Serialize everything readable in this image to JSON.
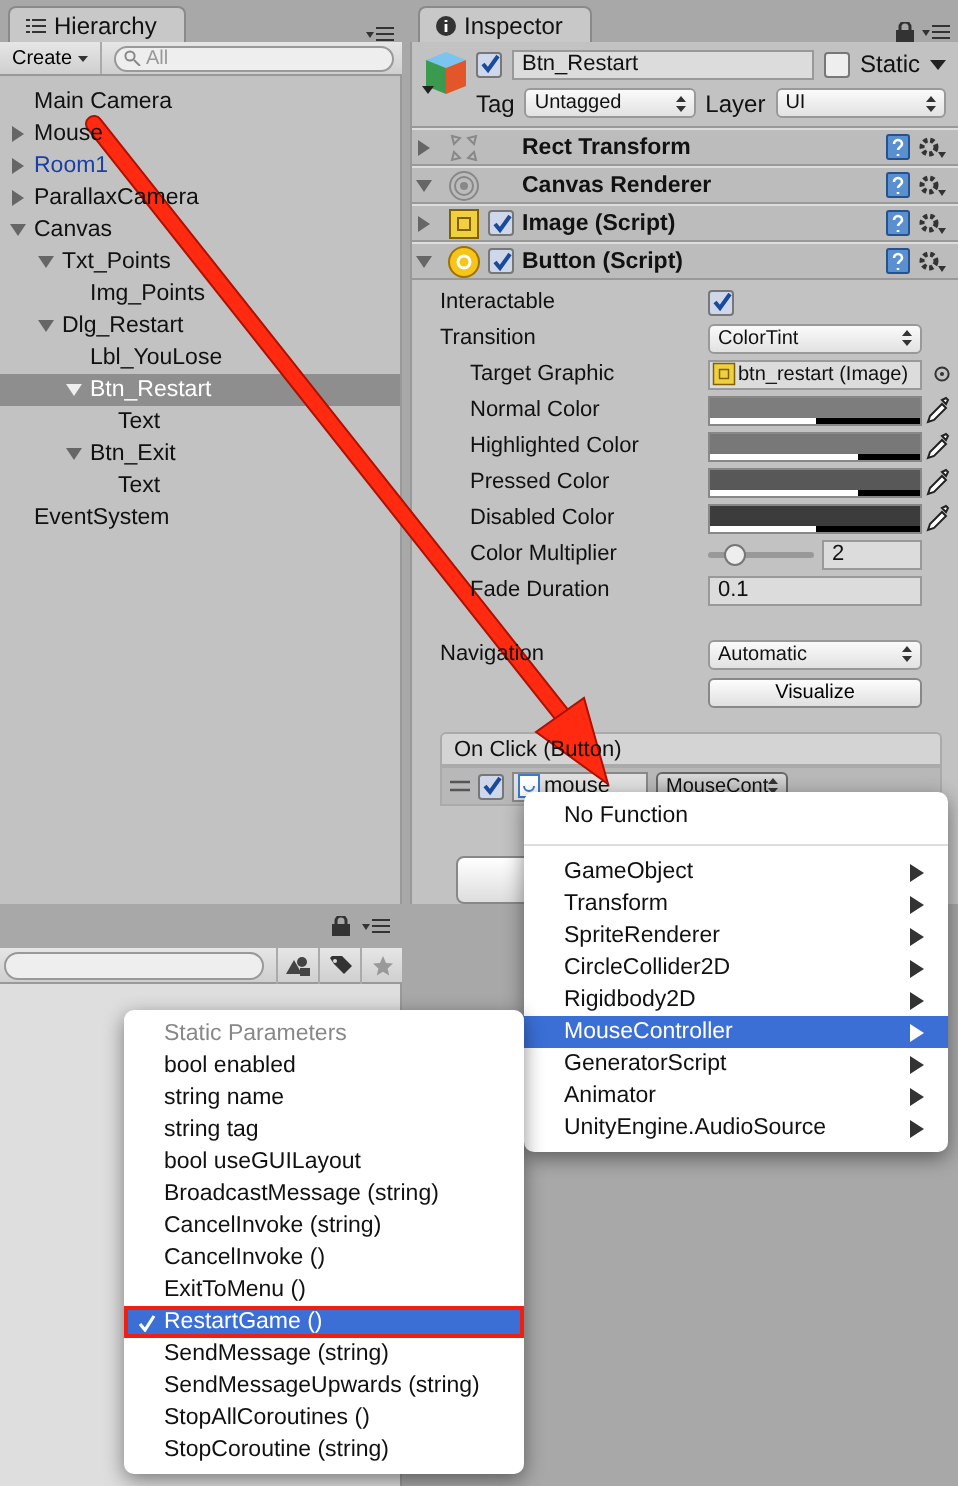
{
  "hierarchy": {
    "tab": "Hierarchy",
    "create_button": "Create",
    "search_placeholder": "All",
    "items": [
      {
        "label": "Main Camera",
        "kind": "object",
        "selected": false
      },
      {
        "label": "Mouse",
        "kind": "object",
        "expanded": false,
        "selected": false
      },
      {
        "label": "Room1",
        "kind": "prefab",
        "expanded": false,
        "selected": false
      },
      {
        "label": "ParallaxCamera",
        "kind": "object",
        "expanded": false,
        "selected": false
      },
      {
        "label": "Canvas",
        "kind": "object",
        "expanded": true,
        "selected": false,
        "children": [
          {
            "label": "Txt_Points",
            "kind": "object",
            "expanded": true,
            "selected": false,
            "children": [
              {
                "label": "Img_Points",
                "kind": "object",
                "selected": false
              }
            ]
          },
          {
            "label": "Dlg_Restart",
            "kind": "object",
            "expanded": true,
            "selected": false,
            "children": [
              {
                "label": "Lbl_YouLose",
                "kind": "object",
                "selected": false
              },
              {
                "label": "Btn_Restart",
                "kind": "object",
                "expanded": true,
                "selected": true,
                "children": [
                  {
                    "label": "Text",
                    "kind": "object",
                    "selected": false
                  }
                ]
              },
              {
                "label": "Btn_Exit",
                "kind": "object",
                "expanded": true,
                "selected": false,
                "children": [
                  {
                    "label": "Text",
                    "kind": "object",
                    "selected": false
                  }
                ]
              }
            ]
          }
        ]
      },
      {
        "label": "EventSystem",
        "kind": "object",
        "selected": false
      }
    ]
  },
  "inspector": {
    "tab": "Inspector",
    "object": {
      "name": "Btn_Restart",
      "active": true,
      "static_label": "Static",
      "static": false,
      "tag_label": "Tag",
      "tag": "Untagged",
      "layer_label": "Layer",
      "layer": "UI"
    },
    "components": [
      {
        "name": "Rect Transform",
        "kind": "rect",
        "expanded": false
      },
      {
        "name": "Canvas Renderer",
        "kind": "canvas",
        "expanded": true
      },
      {
        "name": "Image (Script)",
        "kind": "image",
        "expanded": false,
        "enabled": true
      },
      {
        "name": "Button (Script)",
        "kind": "button",
        "expanded": true,
        "enabled": true
      }
    ],
    "properties": [
      {
        "kind": "checkbox",
        "label": "Interactable",
        "checked": true
      },
      {
        "kind": "dropdown",
        "label": "Transition",
        "value": "ColorTint",
        "children": [
          {
            "kind": "object",
            "label": "Target Graphic",
            "value": "btn_restart (Image)"
          },
          {
            "kind": "color",
            "label": "Normal Color",
            "color": "#7d7d7d",
            "level": 0.5
          },
          {
            "kind": "color",
            "label": "Highlighted Color",
            "color": "#787878",
            "level": 0.7
          },
          {
            "kind": "color",
            "label": "Pressed Color",
            "color": "#585858",
            "level": 0.7
          },
          {
            "kind": "color",
            "label": "Disabled Color",
            "color": "#3c3c3c",
            "level": 0.5
          },
          {
            "kind": "slider",
            "label": "Color Multiplier",
            "level": 0.25,
            "value": "2"
          },
          {
            "kind": "text",
            "label": "Fade Duration",
            "value": "0.1"
          }
        ]
      }
    ],
    "navigation": {
      "label": "Navigation",
      "value": "Automatic",
      "button": "Visualize"
    },
    "on_click": {
      "title": "On Click (Button)",
      "enabled": true,
      "object": "mouse",
      "function": "MouseCont"
    }
  },
  "function_menu": {
    "none_label": "No Function",
    "items": [
      {
        "label": "GameObject",
        "selected": false
      },
      {
        "label": "Transform",
        "selected": false
      },
      {
        "label": "SpriteRenderer",
        "selected": false
      },
      {
        "label": "CircleCollider2D",
        "selected": false
      },
      {
        "label": "Rigidbody2D",
        "selected": false
      },
      {
        "label": "MouseController",
        "selected": true
      },
      {
        "label": "GeneratorScript",
        "selected": false
      },
      {
        "label": "Animator",
        "selected": false
      },
      {
        "label": "UnityEngine.AudioSource",
        "selected": false
      }
    ]
  },
  "method_menu": {
    "header": "Static Parameters",
    "items": [
      {
        "label": "bool enabled",
        "selected": false,
        "outlined": false
      },
      {
        "label": "string name",
        "selected": false,
        "outlined": false
      },
      {
        "label": "string tag",
        "selected": false,
        "outlined": false
      },
      {
        "label": "bool useGUILayout",
        "selected": false,
        "outlined": false
      },
      {
        "label": "BroadcastMessage (string)",
        "selected": false,
        "outlined": false
      },
      {
        "label": "CancelInvoke (string)",
        "selected": false,
        "outlined": false
      },
      {
        "label": "CancelInvoke ()",
        "selected": false,
        "outlined": false
      },
      {
        "label": "ExitToMenu ()",
        "selected": false,
        "outlined": false
      },
      {
        "label": "RestartGame ()",
        "selected": true,
        "outlined": true
      },
      {
        "label": "SendMessage (string)",
        "selected": false,
        "outlined": false
      },
      {
        "label": "SendMessageUpwards (string)",
        "selected": false,
        "outlined": false
      },
      {
        "label": "StopAllCoroutines ()",
        "selected": false,
        "outlined": false
      },
      {
        "label": "StopCoroutine (string)",
        "selected": false,
        "outlined": false
      }
    ]
  }
}
